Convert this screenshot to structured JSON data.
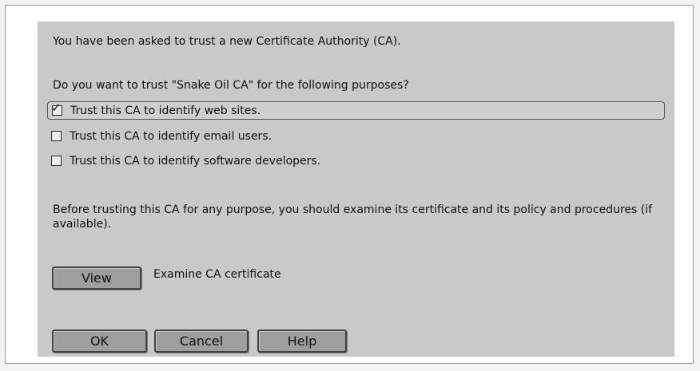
{
  "dialog": {
    "intro": "You have been asked to trust a new Certificate Authority (CA).",
    "question": "Do you want to trust \"Snake Oil CA\" for the following purposes?",
    "options": [
      {
        "label": "Trust this CA to identify web sites.",
        "checked": true
      },
      {
        "label": "Trust this CA to identify email users.",
        "checked": false
      },
      {
        "label": "Trust this CA to identify software developers.",
        "checked": false
      }
    ],
    "note": "Before trusting this CA for any purpose, you should examine its certificate and its policy and procedures (if available).",
    "view_button": "View",
    "view_description": "Examine CA certificate",
    "buttons": {
      "ok": "OK",
      "cancel": "Cancel",
      "help": "Help"
    }
  },
  "colors": {
    "dialog_background": "#c9c9c9",
    "button_background": "#9e9e9e",
    "text": "#111111"
  },
  "icons": {
    "checked": "checkbox-checked-icon",
    "unchecked": "checkbox-unchecked-icon"
  }
}
